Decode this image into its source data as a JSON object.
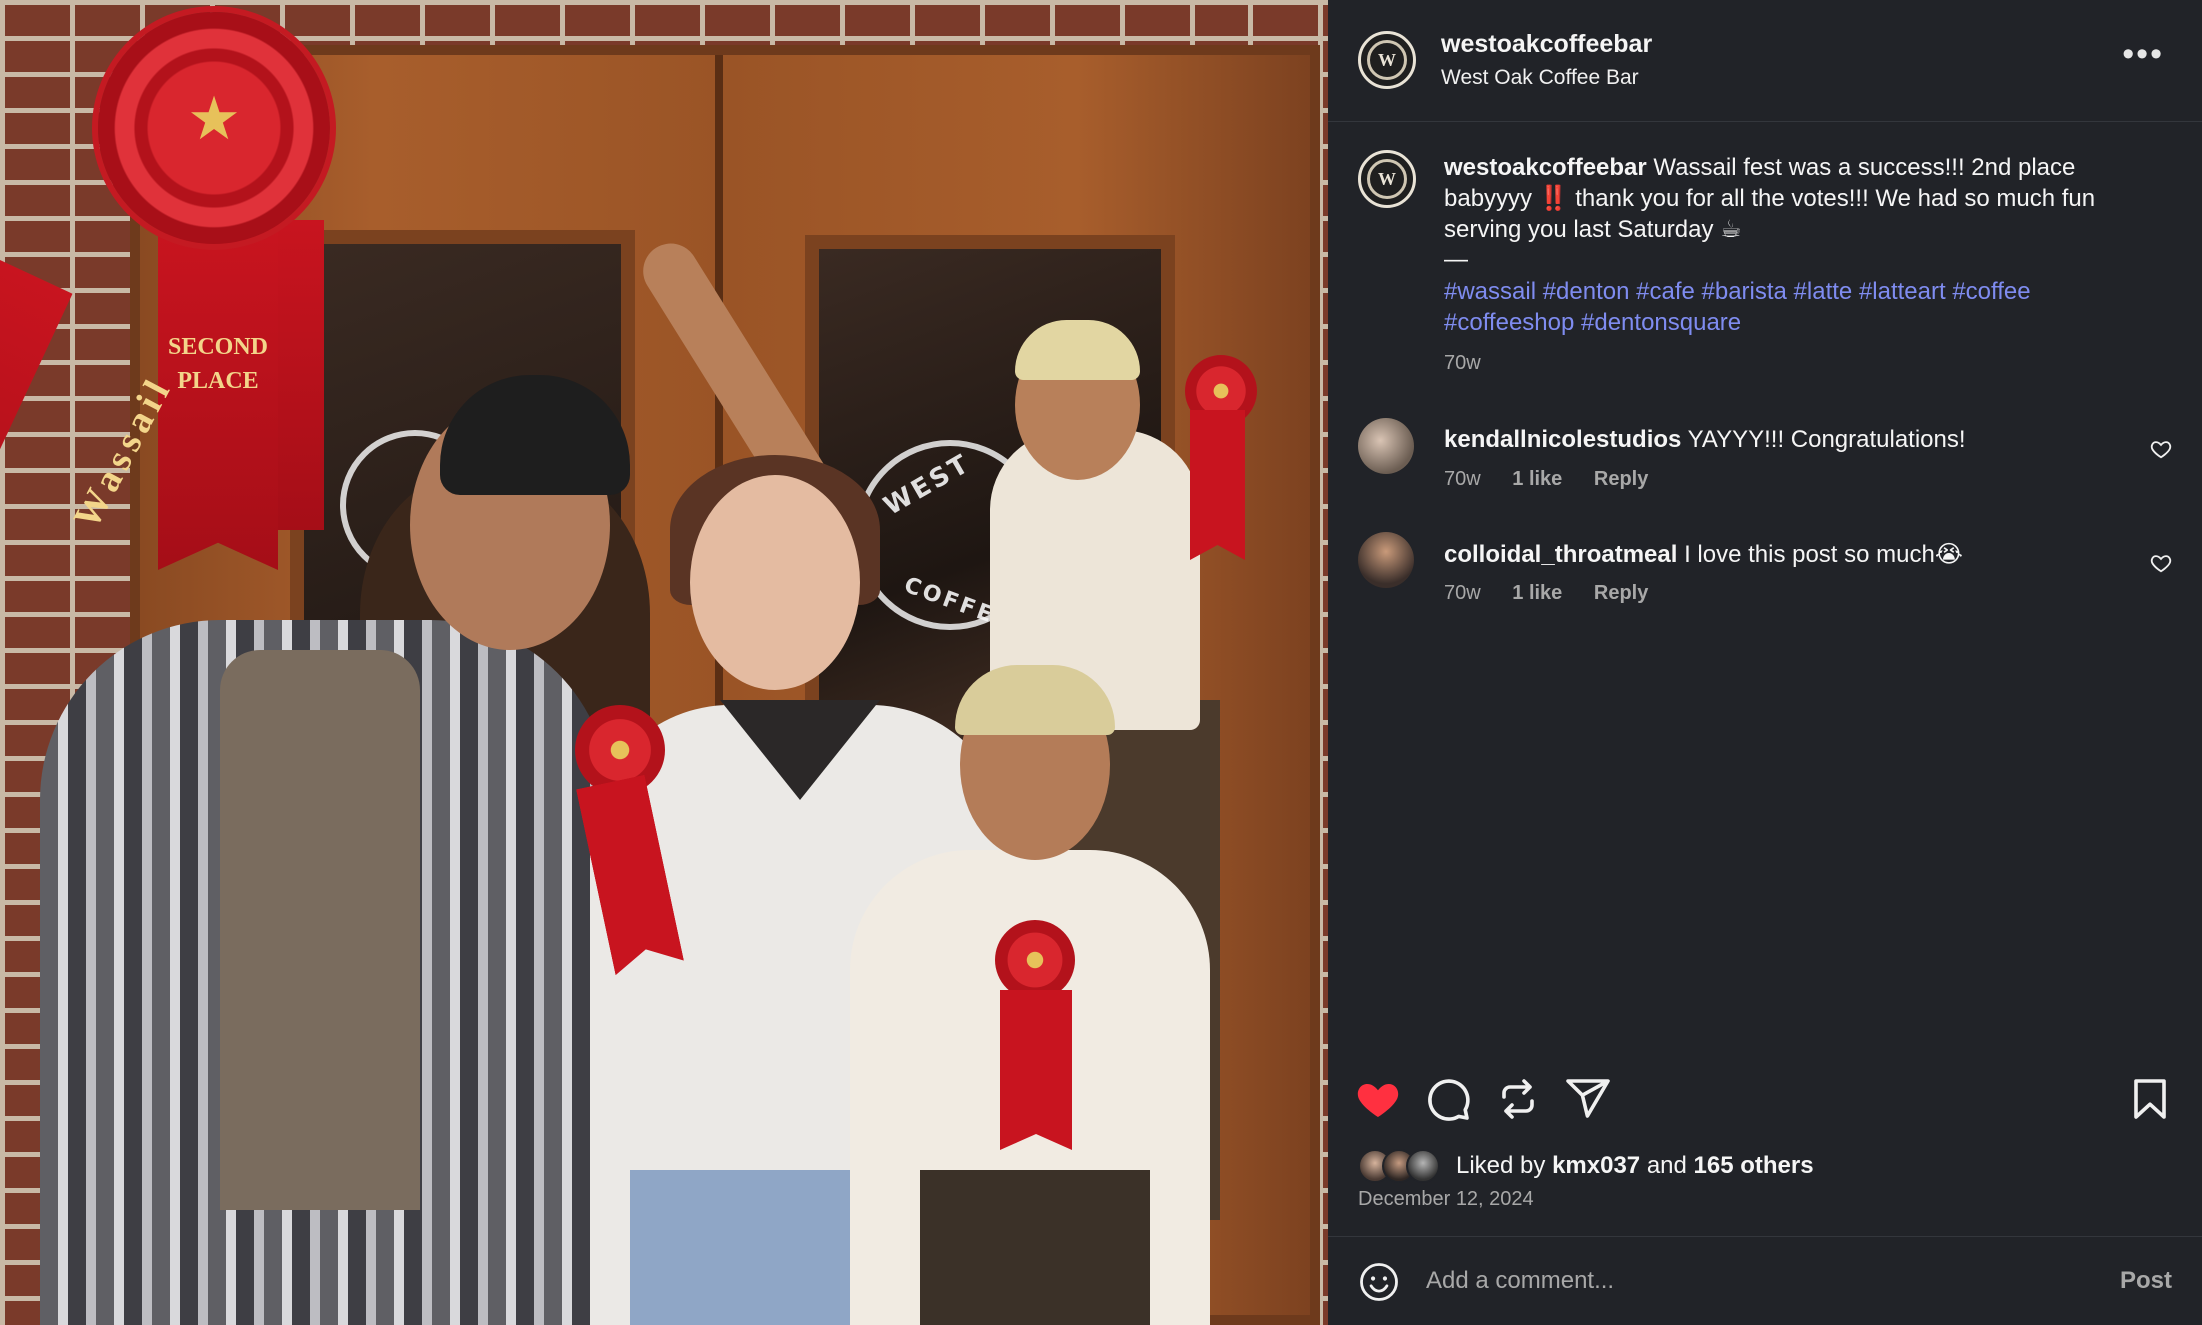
{
  "post": {
    "username": "westoakcoffeebar",
    "display_name": "West Oak Coffee Bar",
    "avatar_monogram": "W",
    "more_label": "•••"
  },
  "photo": {
    "ribbon_text": "SECOND PLACE",
    "ribbon_side": "Wassail",
    "sign_word_1": "WEST",
    "sign_word_2": "COFFEE BA"
  },
  "caption": {
    "username": "westoakcoffeebar",
    "text": "Wassail fest was a success!!! 2nd place babyyyy ‼️ thank you for all the votes!!! We had so much fun serving you last Saturday ☕",
    "dash": "—",
    "hashtags": "#wassail #denton #cafe #barista #latte #latteart #coffee #coffeeshop #dentonsquare",
    "age": "70w"
  },
  "comments": [
    {
      "username": "kendallnicolestudios",
      "text": "YAYYY!!! Congratulations!",
      "age": "70w",
      "likes": "1 like",
      "reply": "Reply"
    },
    {
      "username": "colloidal_throatmeal",
      "text": "I love this post so much😭",
      "age": "70w",
      "likes": "1 like",
      "reply": "Reply"
    }
  ],
  "likes": {
    "prefix": "Liked by",
    "user": "kmx037",
    "and": "and",
    "others": "165 others"
  },
  "date": "December 12, 2024",
  "composer": {
    "placeholder": "Add a comment...",
    "post_label": "Post"
  },
  "colors": {
    "panel_bg": "#212328",
    "hashtag": "#7f8cf0",
    "like_active": "#ff3040"
  },
  "icons": {
    "like": "heart-filled-icon",
    "comment": "comment-icon",
    "repost": "repost-icon",
    "share": "share-icon",
    "save": "bookmark-icon",
    "emoji": "emoji-icon"
  }
}
